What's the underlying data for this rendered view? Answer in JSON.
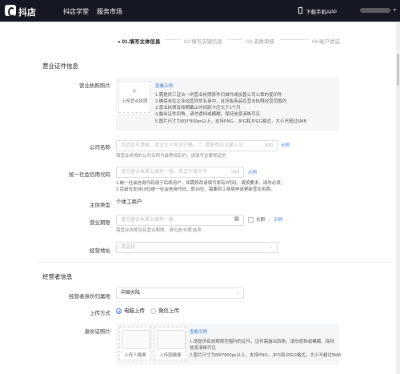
{
  "header": {
    "brand": "抖店",
    "nav": [
      "抖店学堂",
      "服务市场"
    ],
    "download": "下载手机APP"
  },
  "steps": [
    "» 01.填写主体信息",
    "02.填写店铺信息",
    "03.资质审核",
    "04.账户验证"
  ],
  "license_section": {
    "title": "营业证件信息",
    "photo": {
      "label": "营业执照照片",
      "upload_label": "上传营业执照",
      "example_link": "查看示例",
      "requirements": [
        "1.需提供三证合一的营业执照原件扫描件或加盖公司公章的复印件",
        "2.确保未在企业经营异常名录中，且所售商品在营业执照经营范围内",
        "3.营业执照有效期截止时间距今应大于1个月",
        "4.露出证件四角，请勿遮挡或模糊，保持信息清晰可见",
        "5.图片尺寸为800*800px以上，支持PNG、JPG和JPEG格式，大小不超过5MB"
      ]
    },
    "company_name": {
      "label": "公司名称",
      "placeholder": "包括括号请体、英文大小写及空格。（）请使用中文输入法",
      "counter": "0/30",
      "example": "示例",
      "hint": "需营业执照的公司名称为最等规定的，请填写这要规定的"
    },
    "credit_code": {
      "label": "统一社会信用代码",
      "placeholder": "请与营业执照上保持一致，英文字母大写",
      "counter": "0/18",
      "example": "示例",
      "hints": [
        "1.统一社会信用代码用于后续用户，如需修改请填写原有3代码，请按要求，请勿必须；",
        "2.目前仅支持18位统一社会信用代码，即18位，需要到工商局申请更新营业执照。"
      ]
    },
    "entity_type": {
      "label": "主体类型",
      "value": "个体工商户"
    },
    "business_term": {
      "label": "营业期限",
      "placeholder": "请与营业执照上保持一致",
      "longterm": "长期",
      "example": "示例",
      "hint": "需营业执照没有营业期限，请勾选'长期'选项"
    },
    "business_address": {
      "label": "经营地址",
      "placeholder": "请选择"
    }
  },
  "operator_section": {
    "title": "经营者信息",
    "region": {
      "label": "经营者身份归属地",
      "value": "中国大陆"
    },
    "upload_method": {
      "label": "上传方式",
      "options": [
        "电脑上传",
        "微信上传"
      ],
      "selected": "电脑上传"
    },
    "id_photo": {
      "label": "身份证照片",
      "front_label": "上传人像面",
      "back_label": "上传国徽面",
      "example_link": "查看示例",
      "requirements": [
        "1.请提供有效期限范围内的证件，证件需露出四角，请勿遮挡或模糊，保持信息清晰可见",
        "2.图片尺寸为800*800px以上，支持PNG、JPG和JPEG格式，大小不超过5MB"
      ]
    }
  },
  "colors": {
    "accent": "#3a78e0",
    "topbar": "#161823"
  }
}
